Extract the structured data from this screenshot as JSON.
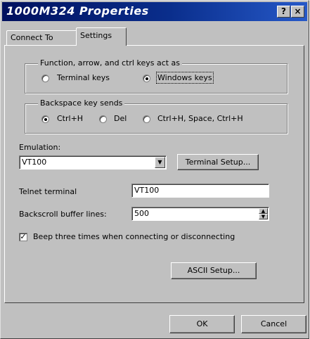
{
  "window": {
    "title": "1000M324 Properties",
    "help_glyph": "?",
    "close_glyph": "×"
  },
  "tabs": [
    {
      "label": "Connect To",
      "selected": false
    },
    {
      "label": "Settings",
      "selected": true
    }
  ],
  "function_keys": {
    "title": "Function, arrow, and ctrl keys act as",
    "options": [
      {
        "label": "Terminal keys",
        "selected": false
      },
      {
        "label": "Windows keys",
        "selected": true
      }
    ]
  },
  "backspace": {
    "title": "Backspace key sends",
    "options": [
      {
        "label": "Ctrl+H",
        "selected": true
      },
      {
        "label": "Del",
        "selected": false
      },
      {
        "label": "Ctrl+H, Space, Ctrl+H",
        "selected": false
      }
    ]
  },
  "emulation": {
    "label": "Emulation:",
    "value": "VT100",
    "dropdown_glyph": "▼",
    "setup_button": "Terminal Setup..."
  },
  "telnet": {
    "label": "Telnet terminal",
    "value": "VT100"
  },
  "backscroll": {
    "label": "Backscroll buffer lines:",
    "value": "500",
    "up_glyph": "▲",
    "down_glyph": "▼"
  },
  "beep": {
    "label": "Beep three times when connecting or disconnecting",
    "checked": true,
    "check_glyph": "✓"
  },
  "ascii_button": "ASCII Setup...",
  "footer": {
    "ok": "OK",
    "cancel": "Cancel"
  },
  "colors": {
    "title_gradient_start": "#00105e",
    "title_gradient_end": "#2659c8",
    "face": "#c0c0c0"
  }
}
